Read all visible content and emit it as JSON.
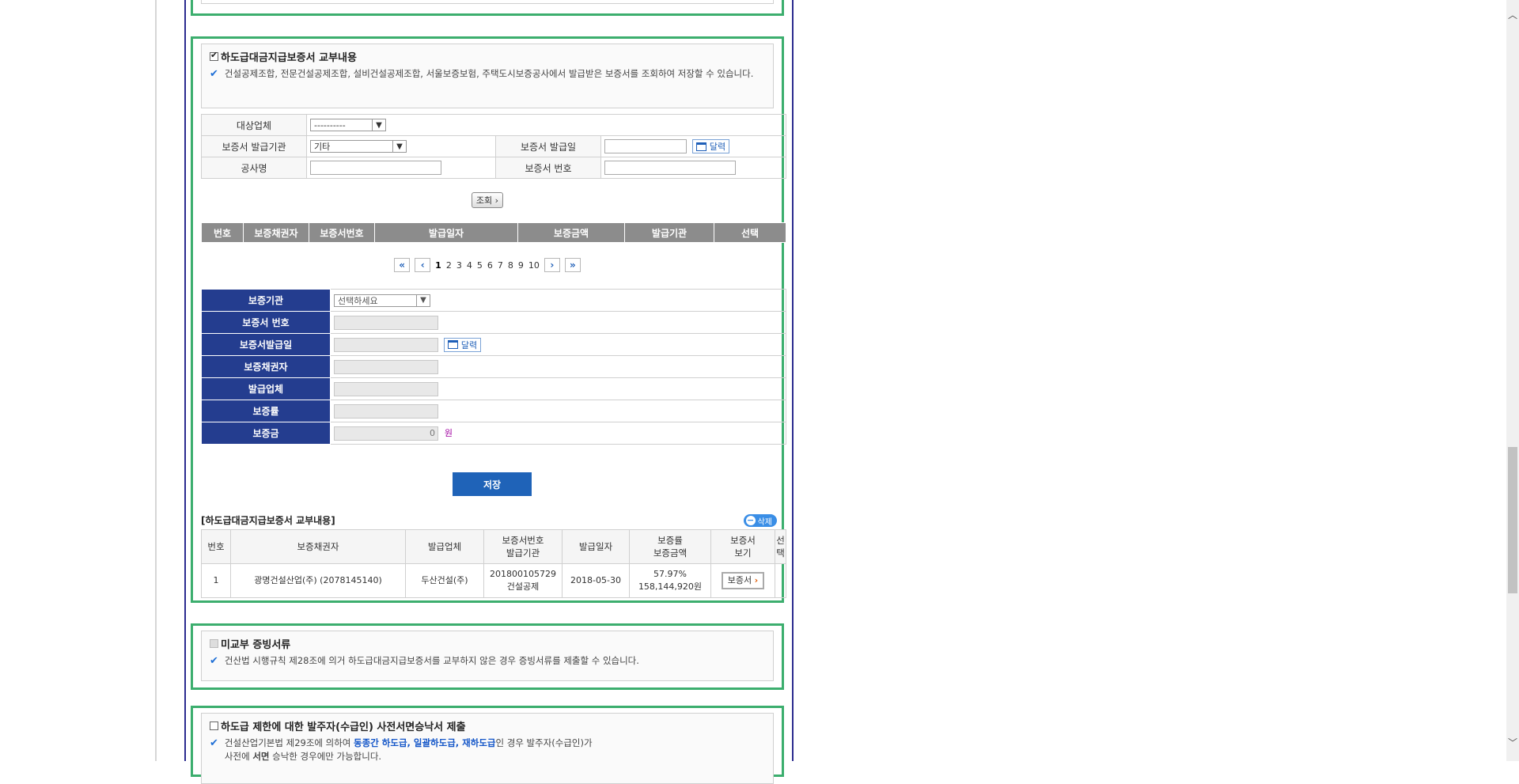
{
  "section1": {
    "title": "하도급대금지급보증서 교부내용",
    "checked": true,
    "note": "건설공제조합, 전문건설공제조합, 설비건설공제조합, 서울보증보험, 주택도시보증공사에서 발급받은 보증서를 조회하여 저장할 수 있습니다.",
    "search": {
      "target_label": "대상업체",
      "target_value": "----------",
      "issuer_label": "보증서 발급기관",
      "issuer_value": "기타",
      "issue_date_label": "보증서 발급일",
      "calendar_label": "달력",
      "project_label": "공사명",
      "cert_no_label": "보증서 번호",
      "search_button": "조회"
    },
    "result_columns": [
      "번호",
      "보증채권자",
      "보증서번호",
      "발급일자",
      "보증금액",
      "발급기관",
      "선택"
    ],
    "pager": {
      "pages": [
        "1",
        "2",
        "3",
        "4",
        "5",
        "6",
        "7",
        "8",
        "9",
        "10"
      ],
      "current": "1"
    },
    "form": {
      "agency_label": "보증기관",
      "agency_value": "선택하세요",
      "cert_no_label": "보증서 번호",
      "issue_date_label": "보증서발급일",
      "calendar_label": "달력",
      "creditor_label": "보증채권자",
      "issuer_label": "발급업체",
      "rate_label": "보증률",
      "amount_label": "보증금",
      "amount_value": "0",
      "amount_unit": "원"
    },
    "save_button": "저장",
    "list": {
      "title": "[하도급대금지급보증서 교부내용]",
      "delete_button": "삭제",
      "columns": {
        "no": "번호",
        "creditor": "보증채권자",
        "issuer": "발급업체",
        "cert_no_line1": "보증서번호",
        "cert_no_line2": "발급기관",
        "issue_date": "발급일자",
        "rate_line1": "보증률",
        "rate_line2": "보증금액",
        "view_line1": "보증서",
        "view_line2": "보기",
        "select": "선택"
      },
      "rows": [
        {
          "no": "1",
          "creditor": "광명건설산업(주) (2078145140)",
          "issuer": "두산건설(주)",
          "cert_no": "201800105729",
          "agency": "건설공제",
          "issue_date": "2018-05-30",
          "rate": "57.97%",
          "amount": "158,144,920원",
          "view_button": "보증서"
        }
      ]
    }
  },
  "section2": {
    "title": "미교부 증빙서류",
    "note": "건산법 시행규칙 제28조에 의거 하도급대금지급보증서를 교부하지 않은 경우 증빙서류를 제출할 수 있습니다."
  },
  "section3": {
    "title": "하도급 제한에 대한 발주자(수급인) 사전서면승낙서 제출",
    "note_part1": "건설산업기본법 제29조에 의하여 ",
    "note_bold": "동종간 하도급, 일괄하도급, 재하도급",
    "note_part2": "인 경우 발주자(수급인)가",
    "note_line2_part1": "사전에 ",
    "note_line2_bold": "서면",
    "note_line2_part2": " 승낙한 경우에만 가능합니다."
  },
  "colors": {
    "frame_green": "#3cae6e",
    "label_navy": "#243d8f",
    "save_blue": "#1f63b8",
    "header_gray": "#8c8c8c"
  }
}
